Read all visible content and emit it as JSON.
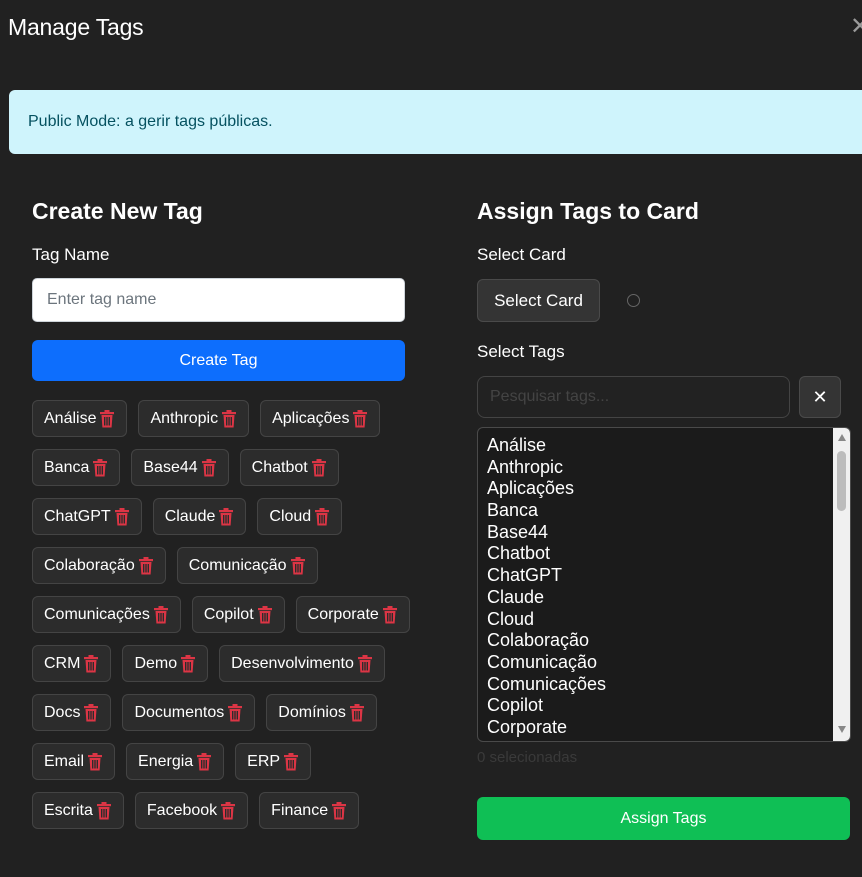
{
  "modal": {
    "title": "Manage Tags",
    "close_icon": "close-icon"
  },
  "alert": {
    "text": "Public Mode: a gerir tags públicas."
  },
  "create": {
    "heading": "Create New Tag",
    "name_label": "Tag Name",
    "name_placeholder": "Enter tag name",
    "button_label": "Create Tag"
  },
  "tags": [
    "Análise",
    "Anthropic",
    "Aplicações",
    "Banca",
    "Base44",
    "Chatbot",
    "ChatGPT",
    "Claude",
    "Cloud",
    "Colaboração",
    "Comunicação",
    "Comunicações",
    "Copilot",
    "Corporate",
    "CRM",
    "Demo",
    "Desenvolvimento",
    "Docs",
    "Documentos",
    "Domínios",
    "Email",
    "Energia",
    "ERP",
    "Escrita",
    "Facebook",
    "Finance"
  ],
  "assign": {
    "heading": "Assign Tags to Card",
    "card_label": "Select Card",
    "card_button": "Select Card",
    "tags_label": "Select Tags",
    "search_placeholder": "Pesquisar tags...",
    "clear_label": "✕",
    "list_items": [
      "Análise",
      "Anthropic",
      "Aplicações",
      "Banca",
      "Base44",
      "Chatbot",
      "ChatGPT",
      "Claude",
      "Cloud",
      "Colaboração",
      "Comunicação",
      "Comunicações",
      "Copilot",
      "Corporate"
    ],
    "selected_count": "0 selecionadas",
    "button_label": "Assign Tags"
  },
  "colors": {
    "primary": "#0d6efd",
    "success": "#0fbf55",
    "danger": "#dc3545",
    "alert_bg": "#cff4fc",
    "alert_text": "#055160"
  }
}
